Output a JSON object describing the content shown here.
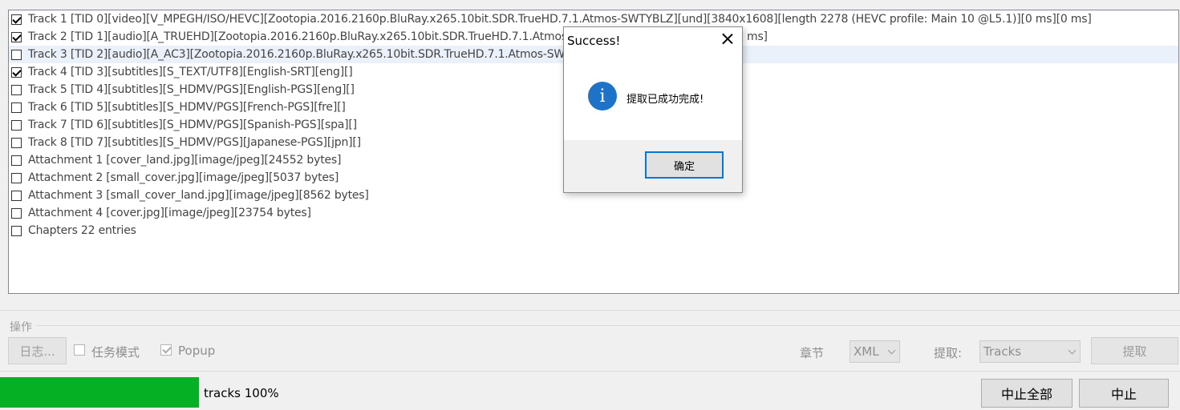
{
  "tracks": [
    {
      "checked": true,
      "label": "Track 1 [TID 0][video][V_MPEGH/ISO/HEVC][Zootopia.2016.2160p.BluRay.x265.10bit.SDR.TrueHD.7.1.Atmos-SWTYBLZ][und][3840x1608][length 2278 (HEVC profile: Main 10 @L5.1)][0 ms][0 ms]"
    },
    {
      "checked": true,
      "label": "Track 2 [TID 1][audio][A_TRUEHD][Zootopia.2016.2160p.BluRay.x265.10bit.SDR.TrueHD.7.1.Atmos-SW",
      "tail": "ms]"
    },
    {
      "checked": false,
      "label": "Track 3 [TID 2][audio][A_AC3][Zootopia.2016.2160p.BluRay.x265.10bit.SDR.TrueHD.7.1.Atmos-SWTYB"
    },
    {
      "checked": true,
      "label": "Track 4 [TID 3][subtitles][S_TEXT/UTF8][English-SRT][eng][]"
    },
    {
      "checked": false,
      "label": "Track 5 [TID 4][subtitles][S_HDMV/PGS][English-PGS][eng][]"
    },
    {
      "checked": false,
      "label": "Track 6 [TID 5][subtitles][S_HDMV/PGS][French-PGS][fre][]"
    },
    {
      "checked": false,
      "label": "Track 7 [TID 6][subtitles][S_HDMV/PGS][Spanish-PGS][spa][]"
    },
    {
      "checked": false,
      "label": "Track 8 [TID 7][subtitles][S_HDMV/PGS][Japanese-PGS][jpn][]"
    },
    {
      "checked": false,
      "label": "Attachment 1 [cover_land.jpg][image/jpeg][24552 bytes]"
    },
    {
      "checked": false,
      "label": "Attachment 2 [small_cover.jpg][image/jpeg][5037 bytes]"
    },
    {
      "checked": false,
      "label": "Attachment 3 [small_cover_land.jpg][image/jpeg][8562 bytes]"
    },
    {
      "checked": false,
      "label": "Attachment 4 [cover.jpg][image/jpeg][23754 bytes]"
    },
    {
      "checked": false,
      "label": "Chapters 22 entries"
    }
  ],
  "operations": {
    "group_title": "操作",
    "log_button": "日志...",
    "task_mode_label": "任务模式",
    "task_mode_checked": false,
    "popup_label": "Popup",
    "popup_checked": true,
    "chapters_label": "章节",
    "chapters_format": "XML",
    "extract_label": "提取:",
    "extract_mode": "Tracks",
    "extract_button": "提取"
  },
  "progress": {
    "fraction": 1.0,
    "text": "tracks  100%",
    "color": "#06b025"
  },
  "buttons": {
    "abort_all": "中止全部",
    "abort": "中止"
  },
  "dialog": {
    "title": "Success!",
    "icon": "info-icon",
    "icon_glyph": "i",
    "message": "提取已成功完成!",
    "ok_label": "确定"
  }
}
